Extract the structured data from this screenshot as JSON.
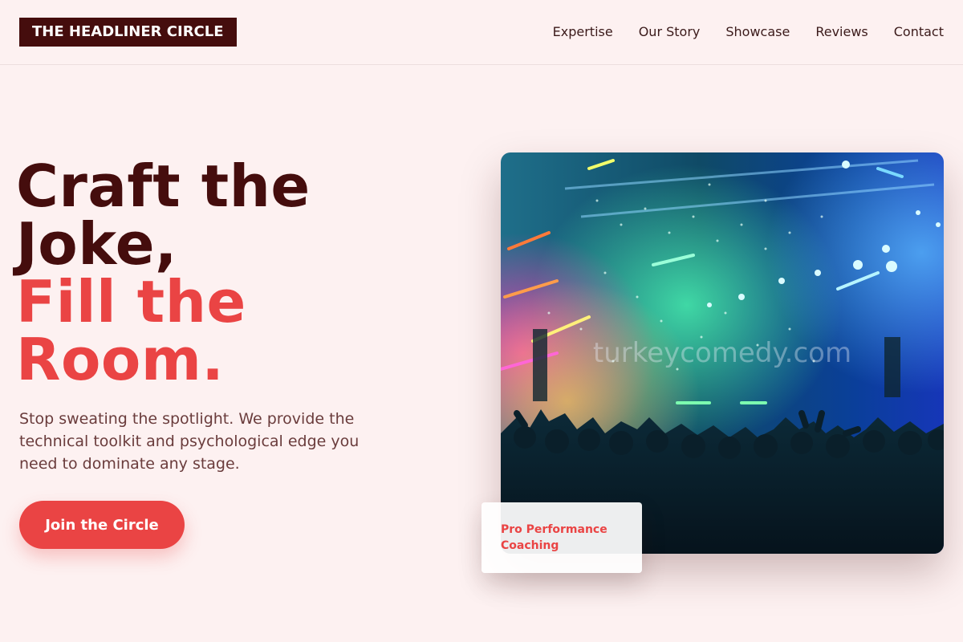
{
  "header": {
    "logo": "THE HEADLINER CIRCLE",
    "nav": [
      {
        "label": "Expertise"
      },
      {
        "label": "Our Story"
      },
      {
        "label": "Showcase"
      },
      {
        "label": "Reviews"
      },
      {
        "label": "Contact"
      }
    ]
  },
  "hero": {
    "title_line1": "Craft the",
    "title_line2": "Joke,",
    "title_line3": "Fill the",
    "title_line4": "Room.",
    "subtitle": "Stop sweating the spotlight. We provide the technical toolkit and psychological edge you need to dominate any stage.",
    "cta_label": "Join the Circle",
    "image_watermark": "turkeycomedy.com",
    "badge_label": "Pro Performance Coaching"
  },
  "colors": {
    "background": "#fdf1f1",
    "brand_dark": "#450d0d",
    "accent": "#ea4444",
    "body_text": "#6a3c3c"
  }
}
